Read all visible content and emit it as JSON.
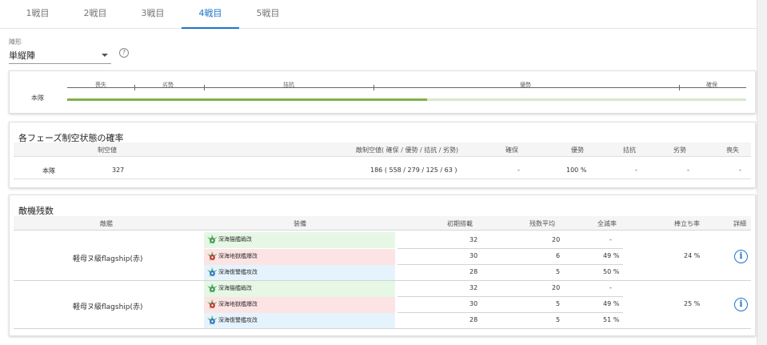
{
  "tabs": [
    {
      "label": "1戦目"
    },
    {
      "label": "2戦目"
    },
    {
      "label": "3戦目"
    },
    {
      "label": "4戦目",
      "active": true
    },
    {
      "label": "5戦目"
    }
  ],
  "formation": {
    "label": "陣形",
    "value": "単縦陣",
    "help_icon": "help-circle-icon"
  },
  "air_state": {
    "scale_labels": [
      "喪失",
      "劣勢",
      "拮抗",
      "優勢",
      "確保"
    ],
    "fleet_label": "本隊",
    "fill_fraction": 0.53,
    "colors": {
      "fill": "#80b146",
      "track": "#d8e8cf"
    }
  },
  "phase_prob": {
    "title": "各フェーズ制空状態の確率",
    "headers": {
      "fighter_power": "制空値",
      "enemy_power": "敵制空値( 確保 / 優勢 / 拮抗 / 劣勢)",
      "kakuho": "確保",
      "yusei": "優勢",
      "kikko": "拮抗",
      "ressei": "劣勢",
      "soshitsu": "喪失"
    },
    "rows": [
      {
        "name": "本隊",
        "fighter_power": "327",
        "enemy_power": "186 ( 558 / 279 / 125 / 63 )",
        "kakuho": "-",
        "yusei": "100 %",
        "kikko": "-",
        "ressei": "-",
        "soshitsu": "-"
      }
    ]
  },
  "enemy_planes": {
    "title": "敵機残数",
    "headers": {
      "ship": "敵艦",
      "equipment": "装備",
      "initial": "初期搭載",
      "avg_remain": "残数平均",
      "annihilation": "全滅率",
      "standing": "棒立ち率",
      "detail": "詳細"
    },
    "ships": [
      {
        "name": "軽母ヌ級flagship(赤)",
        "standing": "24 %",
        "slots": [
          {
            "equip": "深海猫艦戦改",
            "type": "fighter",
            "bg": "#e6f7e6",
            "initial": "32",
            "avg": "20",
            "rate": "-"
          },
          {
            "equip": "深海地獄艦爆改",
            "type": "bomber",
            "bg": "#fde4e4",
            "initial": "30",
            "avg": "6",
            "rate": "49 %"
          },
          {
            "equip": "深海復讐艦攻改",
            "type": "torpedo",
            "bg": "#e5f3fd",
            "initial": "28",
            "avg": "5",
            "rate": "50 %"
          }
        ]
      },
      {
        "name": "軽母ヌ級flagship(赤)",
        "standing": "25 %",
        "slots": [
          {
            "equip": "深海猫艦戦改",
            "type": "fighter",
            "bg": "#e6f7e6",
            "initial": "32",
            "avg": "20",
            "rate": "-"
          },
          {
            "equip": "深海地獄艦爆改",
            "type": "bomber",
            "bg": "#fde4e4",
            "initial": "30",
            "avg": "5",
            "rate": "49 %"
          },
          {
            "equip": "深海復讐艦攻改",
            "type": "torpedo",
            "bg": "#e5f3fd",
            "initial": "28",
            "avg": "5",
            "rate": "51 %"
          }
        ]
      }
    ],
    "detail_icon": "info-circle-icon",
    "accent": "#1e76c9"
  }
}
